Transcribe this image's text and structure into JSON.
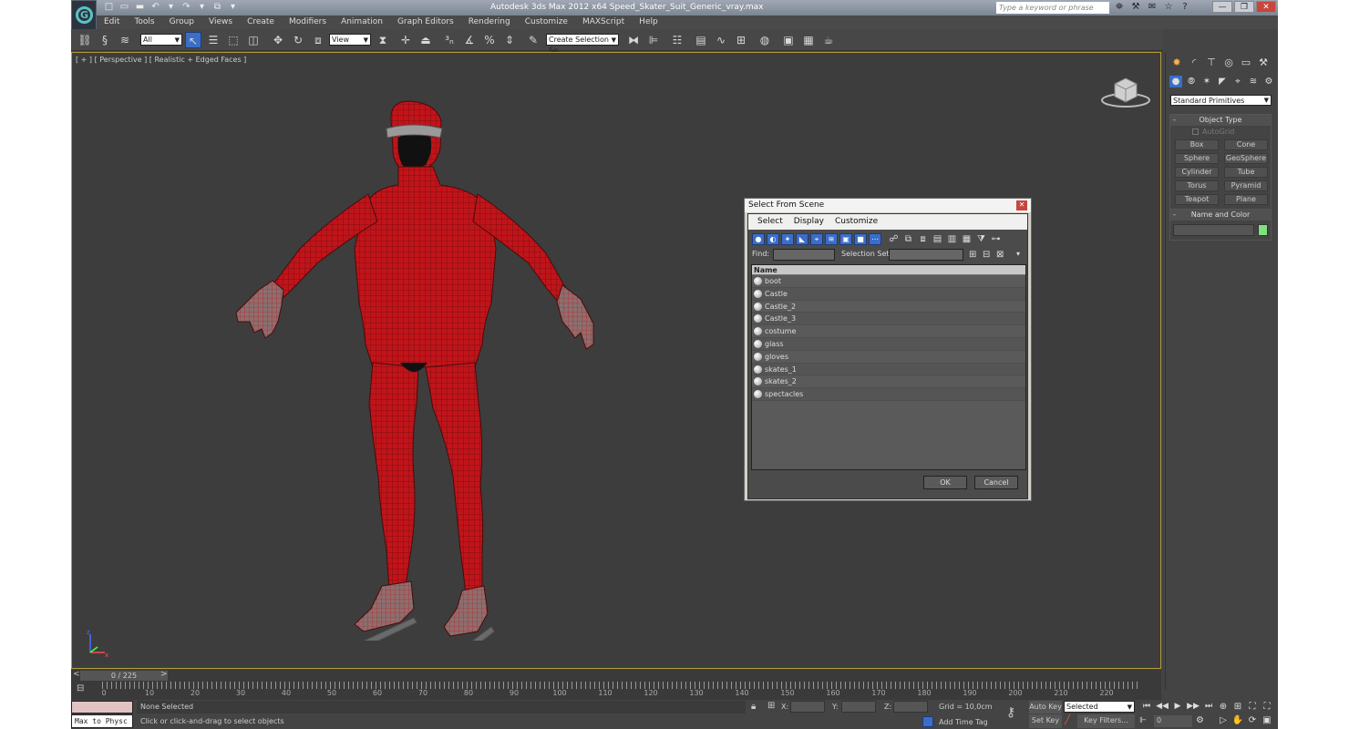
{
  "window": {
    "title": "Autodesk 3ds Max  2012 x64     Speed_Skater_Suit_Generic_vray.max",
    "search_placeholder": "Type a keyword or phrase",
    "controls": [
      "—",
      "❐",
      "✕"
    ]
  },
  "quick_access": [
    "□",
    "▭",
    "▬",
    "↶",
    "▾",
    "↷",
    "▾",
    "⧉",
    "▾"
  ],
  "menu": [
    "Edit",
    "Tools",
    "Group",
    "Views",
    "Create",
    "Modifiers",
    "Animation",
    "Graph Editors",
    "Rendering",
    "Customize",
    "MAXScript",
    "Help"
  ],
  "toolbar": {
    "filter_value": "All",
    "refcoord_value": "View",
    "selection_set_value": "Create Selection Se"
  },
  "viewport": {
    "label": "[ + ] [ Perspective ] [ Realistic + Edged Faces ]",
    "axis_labels": [
      "z",
      "x"
    ]
  },
  "command_panel": {
    "category": "Standard Primitives",
    "object_type_title": "Object Type",
    "autogrid_label": "AutoGrid",
    "buttons": [
      "Box",
      "Cone",
      "Sphere",
      "GeoSphere",
      "Cylinder",
      "Tube",
      "Torus",
      "Pyramid",
      "Teapot",
      "Plane"
    ],
    "name_color_title": "Name and Color",
    "swatch_color": "#7fe07f"
  },
  "dialog": {
    "title": "Select From Scene",
    "menu": [
      "Select",
      "Display",
      "Customize"
    ],
    "find_label": "Find:",
    "selection_set_label": "Selection Set:",
    "list_header": "Name",
    "items": [
      "boot",
      "Castle",
      "Castle_2",
      "Castle_3",
      "costume",
      "glass",
      "gloves",
      "skates_1",
      "skates_2",
      "spectacles"
    ],
    "ok_label": "OK",
    "cancel_label": "Cancel"
  },
  "timeline": {
    "slider_text": "0 / 225",
    "tick_labels": [
      "0",
      "10",
      "20",
      "30",
      "40",
      "50",
      "60",
      "70",
      "80",
      "90",
      "100",
      "110",
      "120",
      "130",
      "140",
      "150",
      "160",
      "170",
      "180",
      "190",
      "200",
      "210",
      "220"
    ]
  },
  "status": {
    "maxscript_label": "Max to Physc",
    "selection_text": "None Selected",
    "hint_text": "Click or click-and-drag to select objects",
    "x_label": "X:",
    "y_label": "Y:",
    "z_label": "Z:",
    "grid_text": "Grid = 10,0cm",
    "add_time_tag": "Add Time Tag",
    "auto_key": "Auto Key",
    "set_key": "Set Key",
    "key_mode_value": "Selected",
    "key_filters": "Key Filters...",
    "frame_value": "0"
  },
  "colors": {
    "suit_red": "#c0141a",
    "viewport_border": "#b59b3a",
    "selected_icon_blue": "#3a6ec8"
  }
}
